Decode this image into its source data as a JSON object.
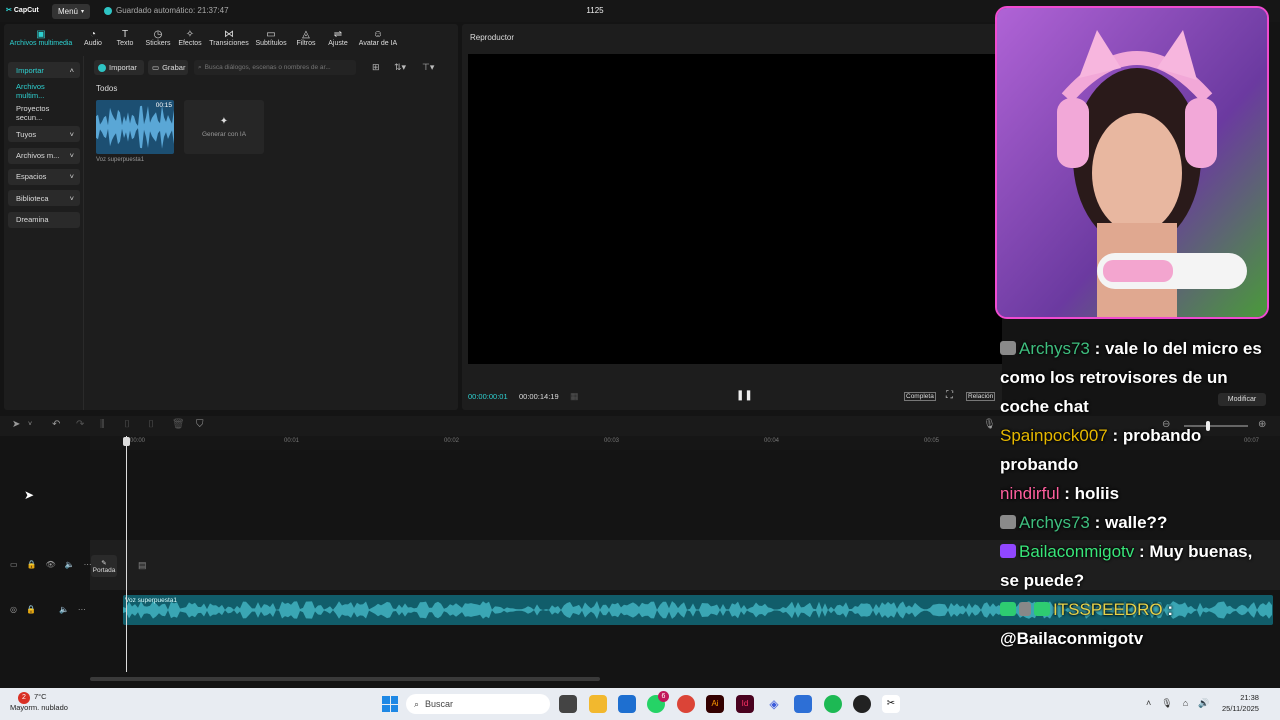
{
  "app": {
    "logo": "CapCut",
    "menu": "Menú",
    "autosave": "Guardado automático: 21:37:47",
    "title": "1125"
  },
  "tools": [
    {
      "label": "Archivos multimedia",
      "icon": "media-icon"
    },
    {
      "label": "Audio",
      "icon": "audio-icon"
    },
    {
      "label": "Texto",
      "icon": "text-icon"
    },
    {
      "label": "Stickers",
      "icon": "sticker-icon"
    },
    {
      "label": "Efectos",
      "icon": "effects-icon"
    },
    {
      "label": "Transiciones",
      "icon": "transitions-icon"
    },
    {
      "label": "Subtítulos",
      "icon": "subtitles-icon"
    },
    {
      "label": "Filtros",
      "icon": "filters-icon"
    },
    {
      "label": "Ajuste",
      "icon": "adjust-icon"
    },
    {
      "label": "Avatar de IA",
      "icon": "ai-avatar-icon"
    }
  ],
  "sidebar": [
    "Importar",
    "Archivos multim...",
    "Proyectos secun...",
    "Tuyos",
    "Archivos m...",
    "Espacios",
    "Biblioteca",
    "Dreamina"
  ],
  "media": {
    "import": "Importar",
    "record": "Grabar",
    "search_placeholder": "Busca diálogos, escenas o nombres de ar...",
    "section": "Todos",
    "clip_duration": "00:15",
    "clip_name": "Voz superpuesta1",
    "generate": "Generar con IA"
  },
  "player": {
    "title": "Reproductor",
    "time_current": "00:00:00:01",
    "time_total": "00:00:14:19",
    "complete": "Completa",
    "relation": "Relación",
    "modify": "Modificar"
  },
  "timeline": {
    "ticks": [
      "00:00",
      "00:01",
      "00:02",
      "00:03",
      "00:04",
      "00:05",
      "00:07"
    ],
    "cover": "Portada",
    "audio_clip": "Voz superpuesta1"
  },
  "chat": [
    {
      "user": "Archys73",
      "color": "#3fbf7f",
      "text": " : vale lo del micro es como los retrovisores de un coche chat",
      "badge": "#8a8a8a"
    },
    {
      "user": "Spainpock007",
      "color": "#e6b800",
      "text": " : probando probando",
      "badge": ""
    },
    {
      "user": "nindirful",
      "color": "#ff5f9e",
      "text": " : holiis",
      "badge": ""
    },
    {
      "user": "Archys73",
      "color": "#3fbf7f",
      "text": " : walle??",
      "badge": "#8a8a8a"
    },
    {
      "user": "Bailaconmigotv",
      "color": "#39e67a",
      "text": " : Muy buenas, se puede?",
      "badge": "#9147ff"
    },
    {
      "user": "ITSSPEEDRO",
      "color": "#e6d24a",
      "text": " : @Bailaconmigotv",
      "badge": "#2ecc71"
    }
  ],
  "taskbar": {
    "temp": "7°C",
    "weather": "Mayorm. nublado",
    "search": "Buscar",
    "time": "21:38",
    "date": "25/11/2025",
    "notif": "2",
    "chrome_badge": "6"
  }
}
